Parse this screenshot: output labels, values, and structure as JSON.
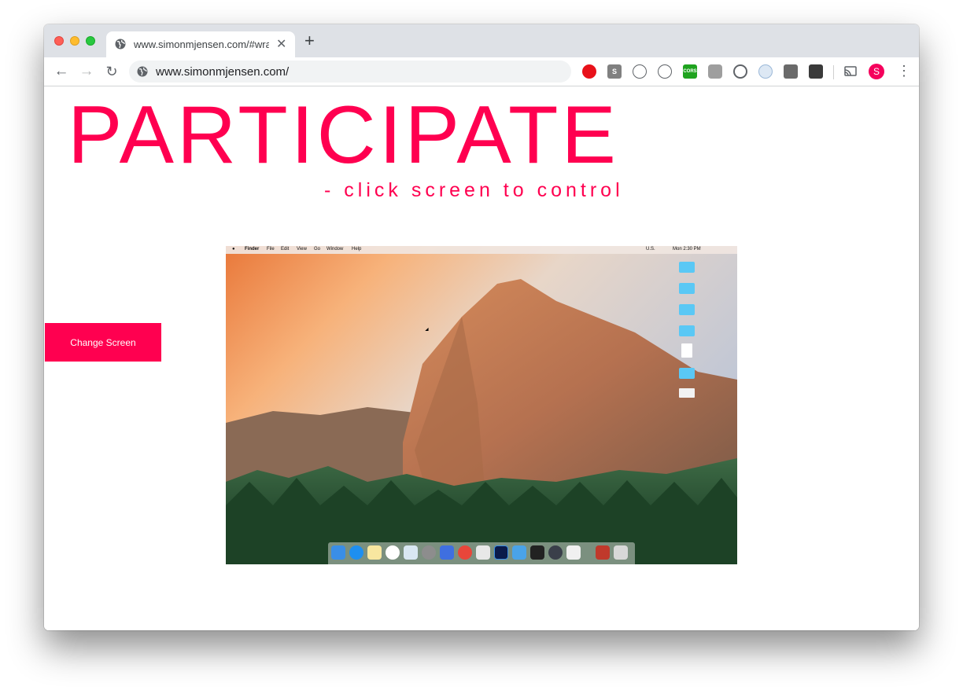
{
  "browser": {
    "tab_title": "www.simonmjensen.com/#wrapper",
    "address": "www.simonmjensen.com/",
    "profile_initial": "S",
    "extensions": [
      "red-hand-icon",
      "s-box-icon",
      "code-brackets-icon",
      "skype-icon",
      "cors-icon",
      "puzzle-icon",
      "drop-icon",
      "circle-ext-icon",
      "facebook-icon",
      "dark-ext-icon",
      "cast-icon"
    ],
    "cors_label": "CORS"
  },
  "page": {
    "title": "PARTICIPATE",
    "subtitle": "- click screen to control",
    "change_button": "Change Screen"
  },
  "remote_screen": {
    "menubar": {
      "app": "Finder",
      "items": [
        "File",
        "Edit",
        "View",
        "Go",
        "Window",
        "Help"
      ],
      "flag_label": "U.S.",
      "clock": "Mon 2:30 PM"
    }
  },
  "colors": {
    "accent": "#ff0050"
  }
}
